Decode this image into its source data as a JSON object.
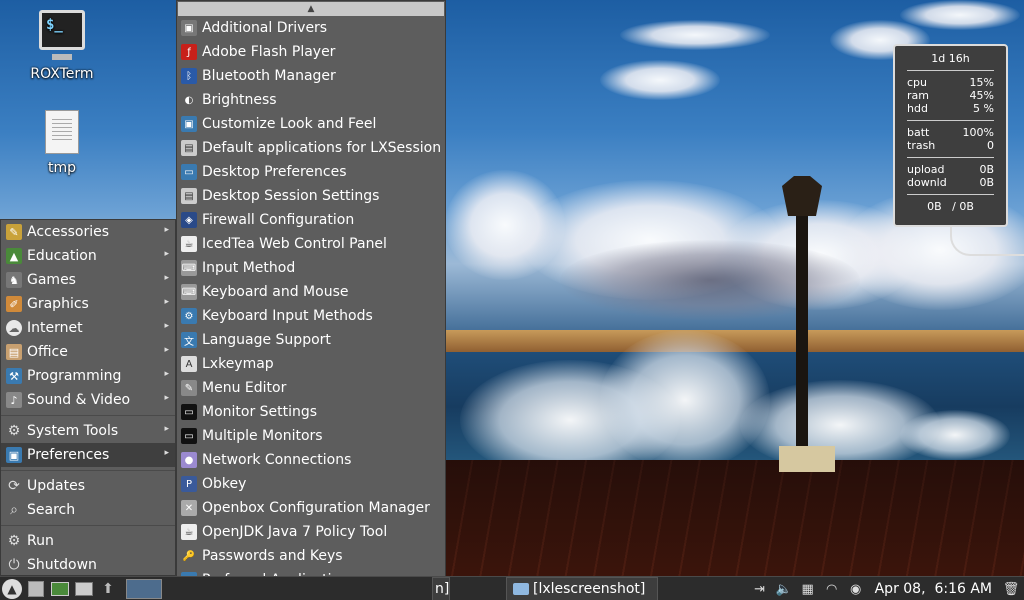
{
  "desktop": {
    "icons": [
      {
        "label": "ROXTerm",
        "icon": "terminal-icon"
      },
      {
        "label": "tmp",
        "icon": "text-file-icon"
      }
    ]
  },
  "main_menu": {
    "items": [
      {
        "label": "Accessories",
        "icon": "accessories-icon",
        "submenu": true
      },
      {
        "label": "Education",
        "icon": "education-icon",
        "submenu": true
      },
      {
        "label": "Games",
        "icon": "games-icon",
        "submenu": true
      },
      {
        "label": "Graphics",
        "icon": "graphics-icon",
        "submenu": true
      },
      {
        "label": "Internet",
        "icon": "internet-icon",
        "submenu": true
      },
      {
        "label": "Office",
        "icon": "office-icon",
        "submenu": true
      },
      {
        "label": "Programming",
        "icon": "programming-icon",
        "submenu": true
      },
      {
        "label": "Sound & Video",
        "icon": "sound-video-icon",
        "submenu": true
      },
      {
        "label": "System Tools",
        "icon": "system-tools-icon",
        "submenu": true
      },
      {
        "label": "Preferences",
        "icon": "preferences-icon",
        "submenu": true,
        "selected": true
      },
      {
        "label": "Updates",
        "icon": "updates-icon",
        "submenu": false
      },
      {
        "label": "Search",
        "icon": "search-icon",
        "submenu": false
      },
      {
        "label": "Run",
        "icon": "run-icon",
        "submenu": false
      },
      {
        "label": "Shutdown",
        "icon": "shutdown-icon",
        "submenu": false
      }
    ]
  },
  "preferences_menu": {
    "items": [
      "Additional Drivers",
      "Adobe Flash Player",
      "Bluetooth Manager",
      "Brightness",
      "Customize Look and Feel",
      "Default applications for LXSession",
      "Desktop Preferences",
      "Desktop Session Settings",
      "Firewall Configuration",
      "IcedTea Web Control Panel",
      "Input Method",
      "Keyboard and Mouse",
      "Keyboard Input Methods",
      "Language Support",
      "Lxkeymap",
      "Menu Editor",
      "Monitor Settings",
      "Multiple Monitors",
      "Network Connections",
      "Obkey",
      "Openbox Configuration Manager",
      "OpenJDK Java 7 Policy Tool",
      "Passwords and Keys",
      "Preferred Applications"
    ]
  },
  "sysmon": {
    "uptime": "1d 16h",
    "cpu_label": "cpu",
    "cpu": "15%",
    "ram_label": "ram",
    "ram": "45%",
    "hdd_label": "hdd",
    "hdd": "5 %",
    "batt_label": "batt",
    "batt": "100%",
    "trash_label": "trash",
    "trash": "0",
    "upload_label": "upload",
    "upload": "0B",
    "downld_label": "downld",
    "downld": "0B",
    "net_total": "0B   / 0B"
  },
  "taskbar": {
    "partial_task": "n]",
    "task_label": "[lxlescreenshot]",
    "clock": "Apr 08,  6:16 AM"
  },
  "colors": {
    "menu_bg": "#5d5d5d",
    "menu_selected": "#3f3f3f",
    "taskbar_bg": "#2c2c2c"
  }
}
